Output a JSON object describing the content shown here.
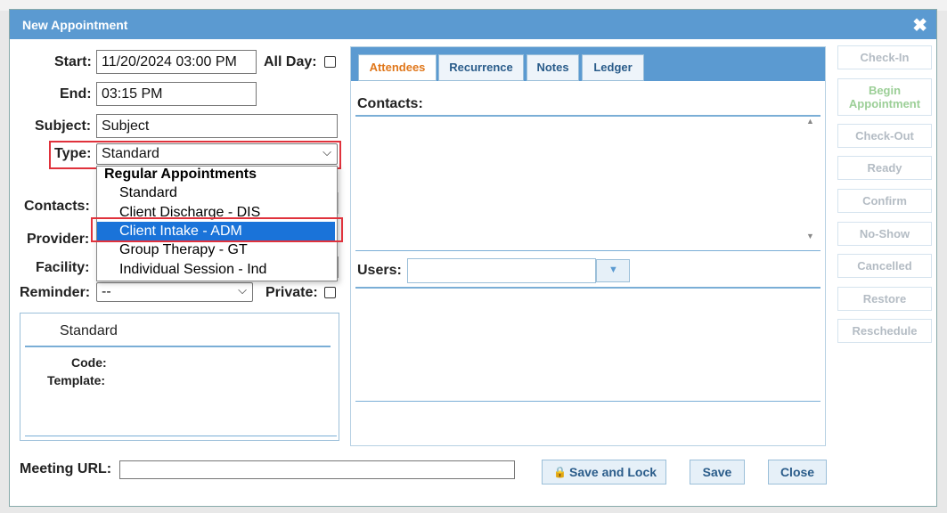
{
  "dialog": {
    "title": "New Appointment",
    "close_glyph": "✖"
  },
  "form": {
    "start_label": "Start:",
    "start_value": "11/20/2024 03:00 PM",
    "allday_label": "All Day:",
    "end_label": "End:",
    "end_value": "03:15 PM",
    "subject_label": "Subject:",
    "subject_value": "Subject",
    "type_label": "Type:",
    "type_value": "Standard",
    "contacts_label": "Contacts:",
    "provider_label": "Provider:",
    "facility_label": "Facility:",
    "reminder_label": "Reminder:",
    "reminder_value": "--",
    "private_label": "Private:",
    "meeting_url_label": "Meeting URL:",
    "meeting_url_value": ""
  },
  "type_dropdown": {
    "group": "Regular Appointments",
    "options": [
      "Standard",
      "Client Discharge - DIS",
      "Client Intake - ADM",
      "Group Therapy - GT",
      "Individual Session - Ind"
    ],
    "highlighted": "Client Intake - ADM"
  },
  "info": {
    "title": "Standard",
    "code_label": "Code:",
    "template_label": "Template:"
  },
  "tabs": [
    {
      "label": "Attendees",
      "active": true
    },
    {
      "label": "Recurrence",
      "active": false
    },
    {
      "label": "Notes",
      "active": false
    },
    {
      "label": "Ledger",
      "active": false
    }
  ],
  "attendees": {
    "contacts_label": "Contacts:",
    "users_label": "Users:",
    "users_value": ""
  },
  "side_buttons": [
    "Check-In",
    "Begin Appointment",
    "Check-Out",
    "Ready",
    "Confirm",
    "No-Show",
    "Cancelled",
    "Restore",
    "Reschedule"
  ],
  "footer": {
    "save_lock": "Save and Lock",
    "save": "Save",
    "close": "Close"
  },
  "icons": {
    "lock": "lock-icon",
    "chevron": "chevron-down-icon",
    "close": "close-icon"
  },
  "colors": {
    "titlebar": "#5b9ad1",
    "highlight": "#1a73d9",
    "callout": "#e0323c",
    "active_tab": "#e0771b"
  }
}
